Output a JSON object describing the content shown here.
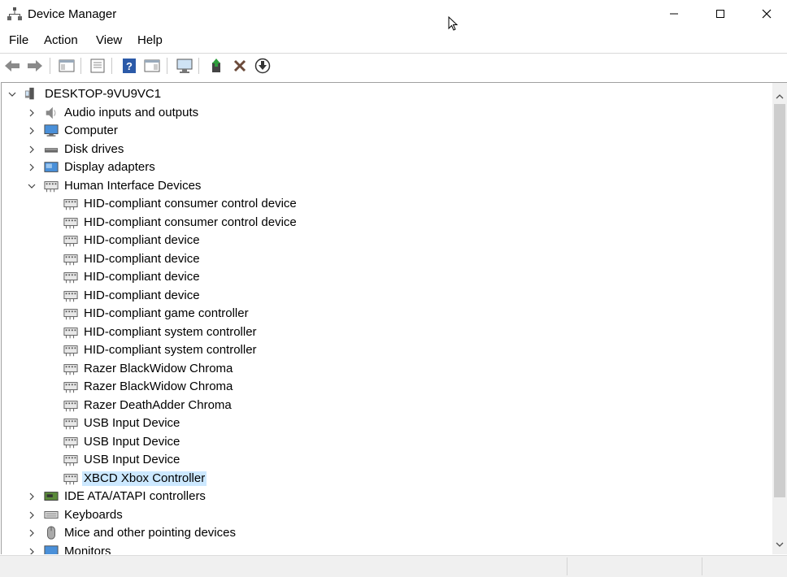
{
  "window": {
    "title": "Device Manager"
  },
  "menu": [
    "File",
    "Action",
    "View",
    "Help"
  ],
  "toolbar": {
    "buttons": [
      "back-icon",
      "forward-icon",
      "show-hide-console-tree-icon",
      "properties-icon",
      "help-icon",
      "action-pane-icon",
      "monitor-icon",
      "update-driver-icon",
      "uninstall-icon",
      "disable-device-icon"
    ]
  },
  "tree": {
    "root": "DESKTOP-9VU9VC1",
    "categories": [
      {
        "label": "Audio inputs and outputs",
        "icon": "speaker-icon"
      },
      {
        "label": "Computer",
        "icon": "computer-icon"
      },
      {
        "label": "Disk drives",
        "icon": "disk-drive-icon"
      },
      {
        "label": "Display adapters",
        "icon": "display-adapter-icon"
      },
      {
        "label": "Human Interface Devices",
        "icon": "hid-icon",
        "expanded": true
      },
      {
        "label": "IDE ATA/ATAPI controllers",
        "icon": "ide-controller-icon"
      },
      {
        "label": "Keyboards",
        "icon": "keyboard-icon"
      },
      {
        "label": "Mice and other pointing devices",
        "icon": "mouse-icon"
      },
      {
        "label": "Monitors",
        "icon": "monitor-icon"
      }
    ],
    "hid_children": [
      "HID-compliant consumer control device",
      "HID-compliant consumer control device",
      "HID-compliant device",
      "HID-compliant device",
      "HID-compliant device",
      "HID-compliant device",
      "HID-compliant game controller",
      "HID-compliant system controller",
      "HID-compliant system controller",
      "Razer BlackWidow Chroma",
      "Razer BlackWidow Chroma",
      "Razer DeathAdder Chroma",
      "USB Input Device",
      "USB Input Device",
      "USB Input Device",
      "XBCD Xbox Controller"
    ],
    "selected": "XBCD Xbox Controller"
  },
  "colors": {
    "selection": "#cce8ff",
    "accent": "#2b6cb0"
  }
}
